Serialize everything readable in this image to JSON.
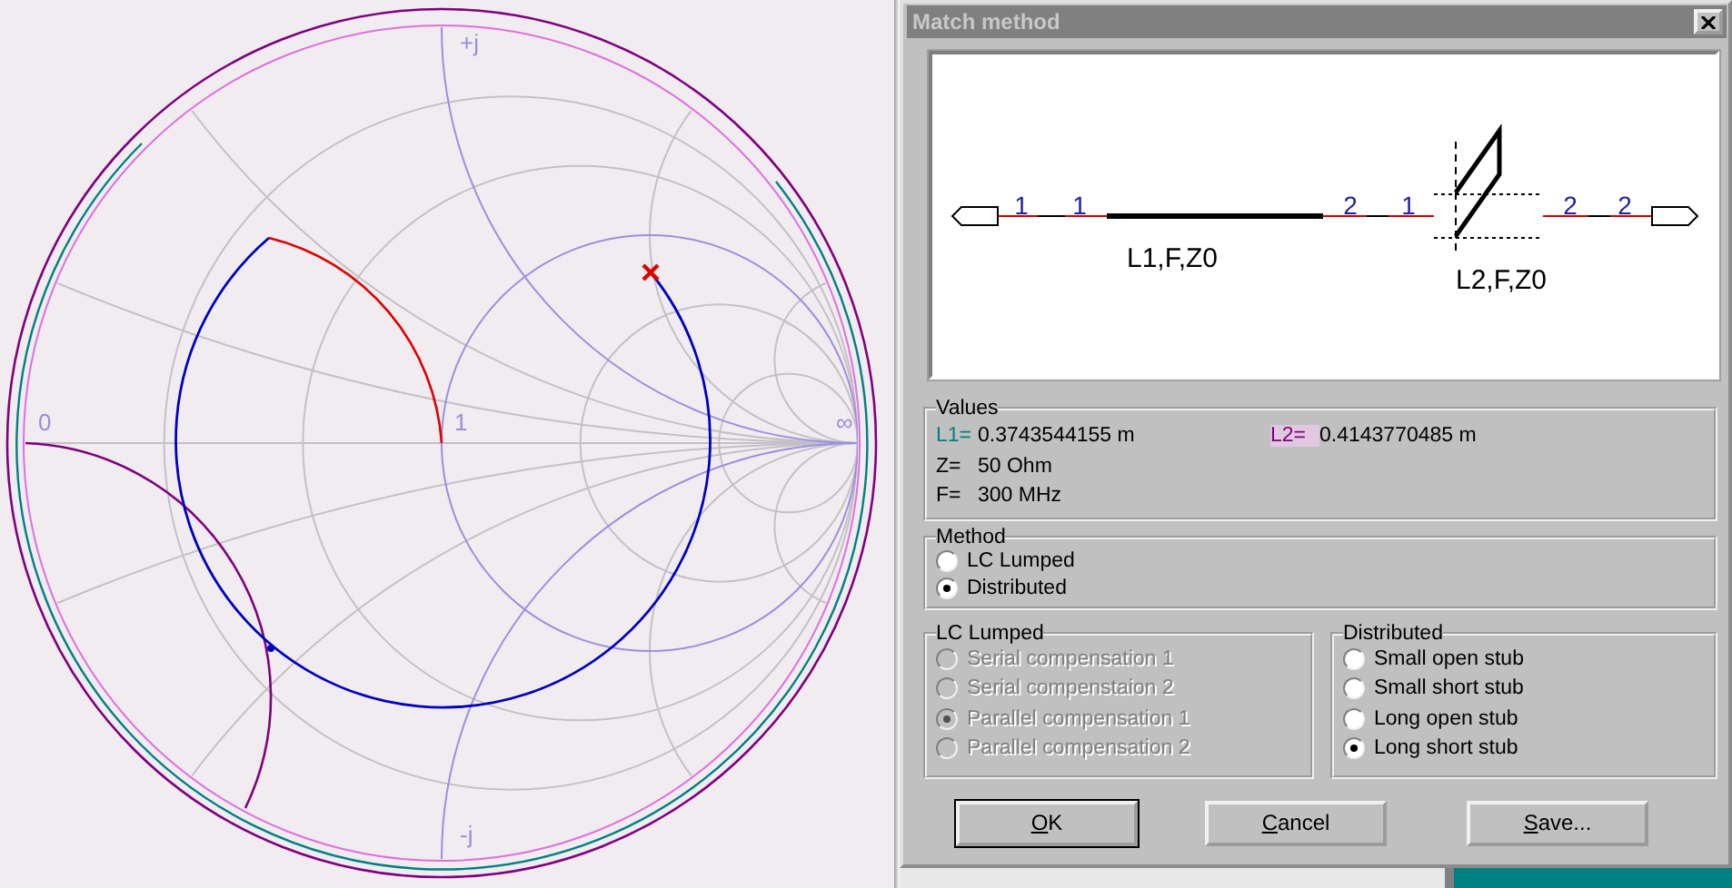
{
  "smith_chart": {
    "axis_labels": [
      {
        "text": "+j",
        "kind": "top"
      },
      {
        "text": "-j",
        "kind": "bottom"
      },
      {
        "text": "0",
        "kind": "left"
      },
      {
        "text": "1",
        "kind": "center"
      },
      {
        "text": "∞",
        "kind": "right"
      }
    ]
  },
  "dialog": {
    "title": "Match method",
    "schematic": {
      "port_labels": [
        "1",
        "1",
        "2",
        "1",
        "2",
        "2"
      ],
      "component_labels": [
        "L1,F,Z0",
        "L2,F,Z0"
      ]
    },
    "values": {
      "title": "Values",
      "rows": [
        {
          "label": "L1=",
          "value": "0.3743544155 m",
          "color": "#008080",
          "highlighted": false
        },
        {
          "label": "L2=",
          "value": "0.4143770485 m",
          "color": "#800080",
          "highlighted": true
        },
        {
          "label": "Z=",
          "value": "50 Ohm",
          "color": "#000000",
          "highlighted": false
        },
        {
          "label": "F=",
          "value": "300 MHz",
          "color": "#000000",
          "highlighted": false
        }
      ]
    },
    "method": {
      "title": "Method",
      "options": [
        {
          "label": "LC Lumped",
          "selected": false,
          "disabled": false
        },
        {
          "label": "Distributed",
          "selected": true,
          "disabled": false
        }
      ]
    },
    "lc_lumped": {
      "title": "LC Lumped",
      "options": [
        {
          "label": "Serial compensation 1",
          "selected": false,
          "disabled": true
        },
        {
          "label": "Serial compenstaion 2",
          "selected": false,
          "disabled": true
        },
        {
          "label": "Parallel compensation 1",
          "selected": true,
          "disabled": true
        },
        {
          "label": "Parallel compensation 2",
          "selected": false,
          "disabled": true
        }
      ]
    },
    "distributed": {
      "title": "Distributed",
      "options": [
        {
          "label": "Small open stub",
          "selected": false,
          "disabled": false
        },
        {
          "label": "Small short stub",
          "selected": false,
          "disabled": false
        },
        {
          "label": "Long open stub",
          "selected": false,
          "disabled": false
        },
        {
          "label": "Long short stub",
          "selected": true,
          "disabled": false
        }
      ]
    },
    "buttons": [
      {
        "label": "OK",
        "default": true
      },
      {
        "label": "Cancel",
        "default": false
      },
      {
        "label": "Save...",
        "default": false
      }
    ]
  }
}
